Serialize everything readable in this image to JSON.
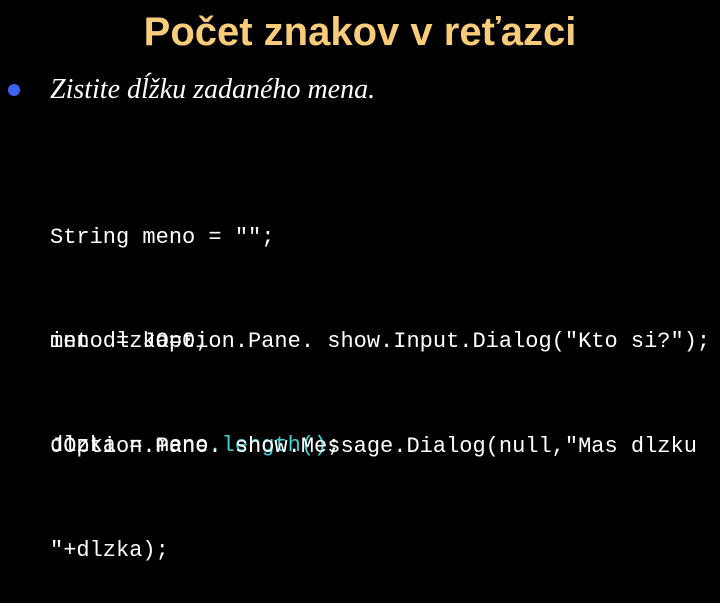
{
  "slide": {
    "title": "Počet znakov v reťazci",
    "bullet": {
      "icon": "bullet-dot",
      "text": "Zistite dĺžku zadaného mena."
    },
    "code_blocks": [
      {
        "lines": [
          "String meno = \"\";",
          "int dlzka=0;"
        ]
      },
      {
        "lines": [
          "meno = JOption.Pane. show.Input.Dialog(\"Kto si?\");"
        ],
        "line2": {
          "prefix": "dlzka = meno",
          "highlight": ".length()",
          "suffix": ";"
        }
      },
      {
        "lines": [
          "JOption.Pane. show.Message.Dialog(null,\"Mas dlzku",
          "\"+dlzka);"
        ]
      }
    ],
    "colors": {
      "background": "#000000",
      "title": "#F9CC79",
      "bullet": "#3D63F2",
      "text": "#FFFFFF",
      "highlight": "#3FD1D6"
    }
  }
}
